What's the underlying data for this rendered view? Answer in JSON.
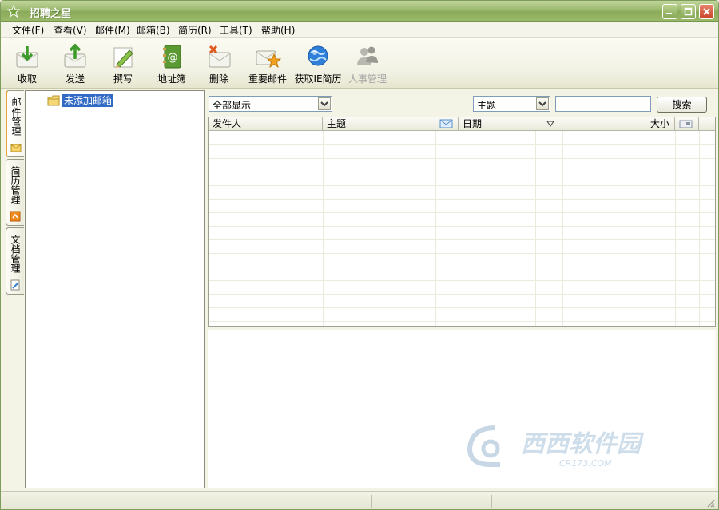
{
  "window": {
    "title": "招聘之星"
  },
  "menu": [
    {
      "label": "文件(F)"
    },
    {
      "label": "查看(V)"
    },
    {
      "label": "邮件(M)"
    },
    {
      "label": "邮箱(B)"
    },
    {
      "label": "简历(R)"
    },
    {
      "label": "工具(T)"
    },
    {
      "label": "帮助(H)"
    }
  ],
  "toolbar": [
    {
      "label": "收取",
      "icon": "receive-envelope-icon"
    },
    {
      "label": "发送",
      "icon": "send-envelope-icon"
    },
    {
      "label": "撰写",
      "icon": "compose-pencil-icon"
    },
    {
      "label": "地址簿",
      "icon": "address-book-icon"
    },
    {
      "label": "删除",
      "icon": "delete-envelope-icon"
    },
    {
      "label": "重要邮件",
      "icon": "important-star-icon"
    },
    {
      "label": "获取IE简历",
      "icon": "ie-globe-icon"
    },
    {
      "label": "人事管理",
      "icon": "people-icon",
      "disabled": true
    }
  ],
  "sidetabs": [
    {
      "label": "邮件管理",
      "active": true
    },
    {
      "label": "简历管理"
    },
    {
      "label": "文档管理"
    }
  ],
  "tree": {
    "node_label": "未添加邮箱"
  },
  "filter": {
    "display_value": "全部显示",
    "field_value": "主题",
    "search_value": "",
    "search_button": "搜索"
  },
  "columns": {
    "sender": "发件人",
    "subject": "主题",
    "date": "日期",
    "size": "大小"
  },
  "watermark": {
    "brand": "西西软件园",
    "domain": "CR173.COM"
  },
  "colors": {
    "titlebar": "#9cba6e",
    "selection": "#316ac5",
    "accent_orange": "#e8a33a"
  }
}
